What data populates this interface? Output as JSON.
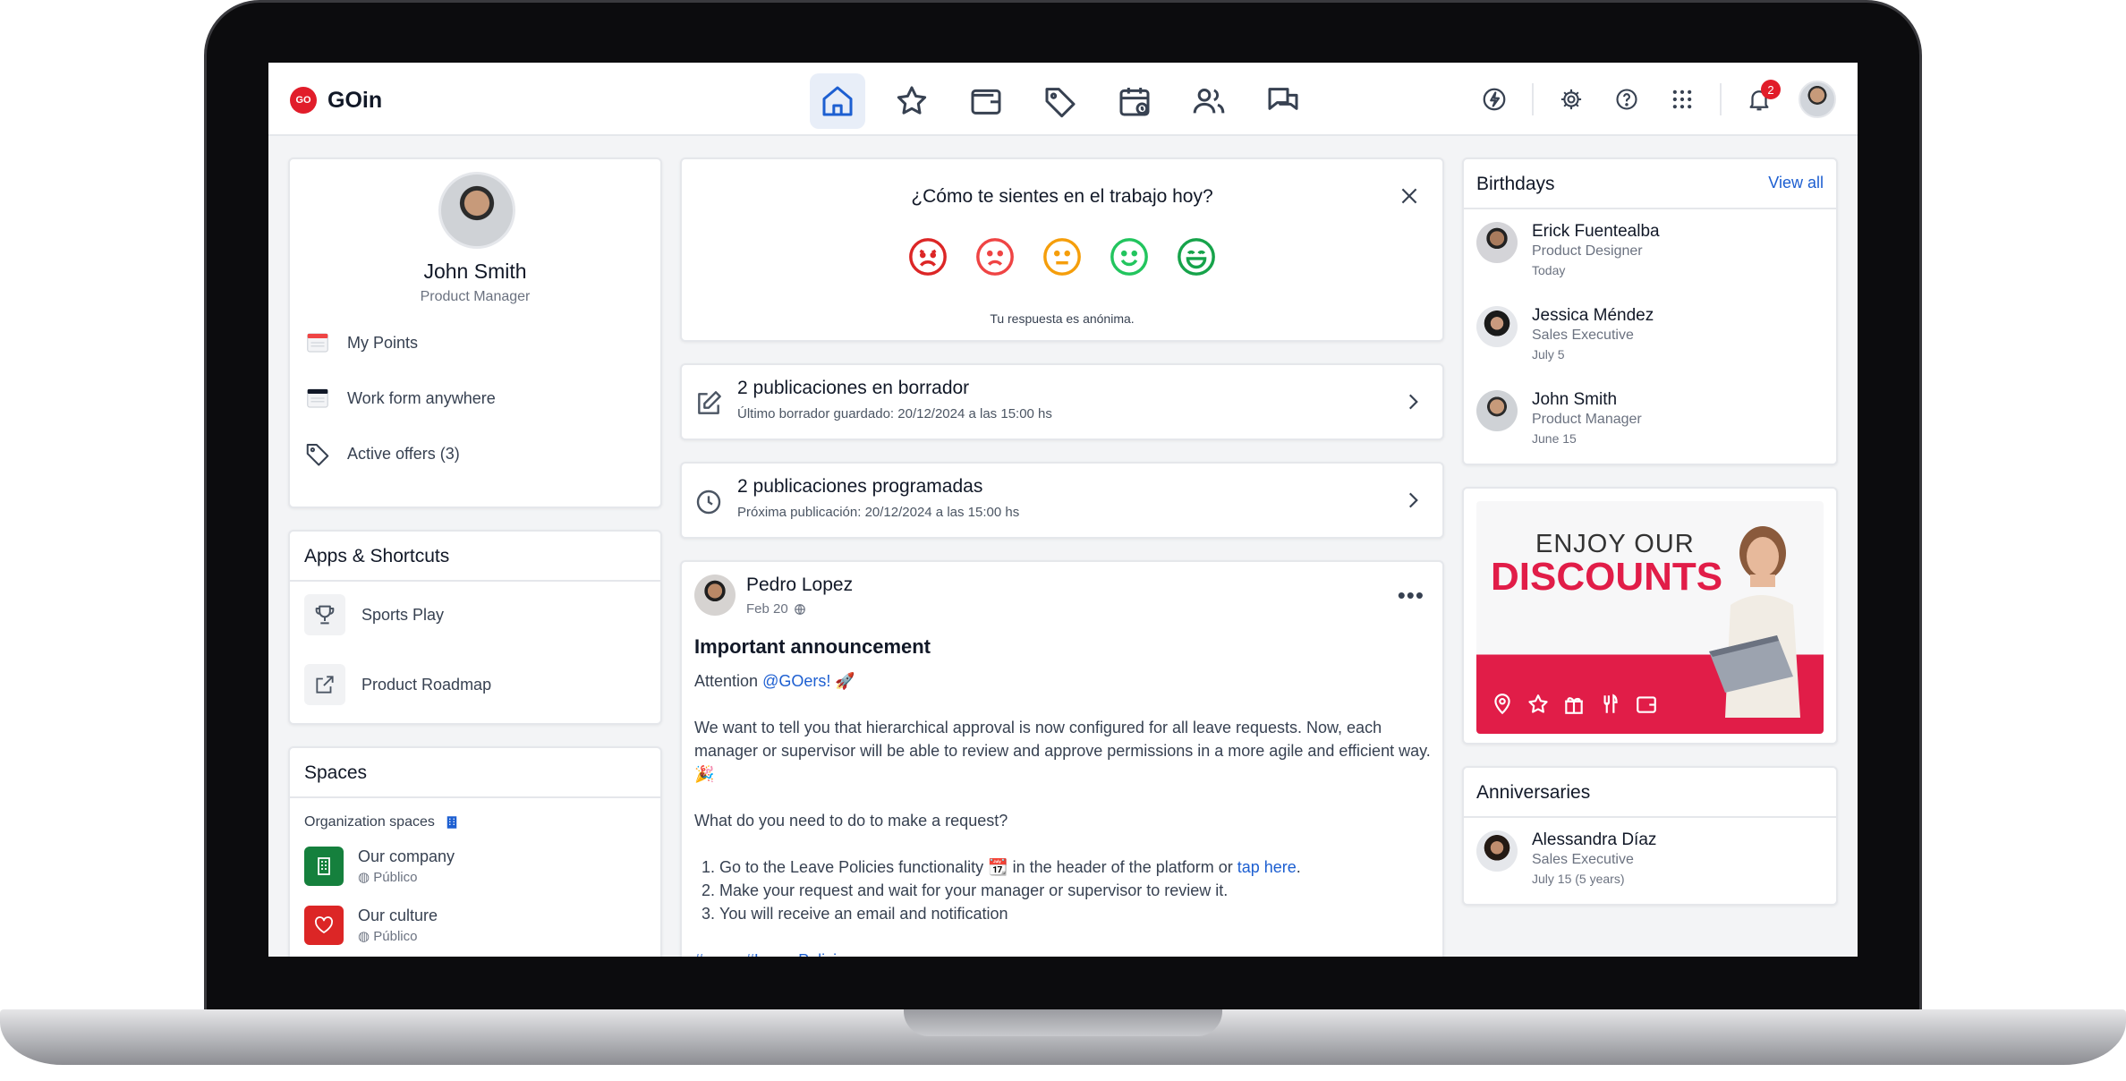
{
  "app": {
    "logo_badge": "GO",
    "name": "GOin"
  },
  "nav": {
    "icons": [
      "home-icon",
      "star-icon",
      "wallet-icon",
      "tag-icon",
      "calendar-icon",
      "people-icon",
      "chat-icon"
    ],
    "active": "home-icon"
  },
  "topbar": {
    "notification_count": "2"
  },
  "profile": {
    "name": "John Smith",
    "role": "Product Manager",
    "links": [
      "My Points",
      "Work form anywhere",
      "Active offers (3)"
    ]
  },
  "apps": {
    "title": "Apps & Shortcuts",
    "items": [
      "Sports Play",
      "Product Roadmap"
    ]
  },
  "spaces": {
    "title": "Spaces",
    "section": "Organization spaces",
    "items": [
      {
        "name": "Our company",
        "visibility": "Público",
        "color": "#15803d"
      },
      {
        "name": "Our culture",
        "visibility": "Público",
        "color": "#dc2626"
      }
    ]
  },
  "mood": {
    "question": "¿Cómo te sientes en el trabajo hoy?",
    "note": "Tu respuesta es anónima.",
    "face_colors": [
      "#dc2626",
      "#ef4444",
      "#f59e0b",
      "#22c55e",
      "#16a34a"
    ]
  },
  "drafts": {
    "title": "2 publicaciones en borrador",
    "subtitle": "Último borrador guardado: 20/12/2024 a las 15:00 hs"
  },
  "scheduled": {
    "title": "2 publicaciones programadas",
    "subtitle": "Próxima publicación: 20/12/2024 a las 15:00 hs"
  },
  "post": {
    "author": "Pedro Lopez",
    "date": "Feb 20",
    "title": "Important announcement",
    "attention": "Attention ",
    "mention": "@GOers!",
    "attention_emoji": "🚀",
    "para1": "We want to tell you that hierarchical approval is now configured for all leave requests. Now, each manager or supervisor will be able to review and approve permissions in a more agile and efficient way. 🎉",
    "question": "What do you need to do to make a request?",
    "step1_pre": "Go to the Leave Policies functionality 📆 in the header of the platform or ",
    "step1_link": "tap here",
    "step1_post": ".",
    "step2": "Make your request and wait for your manager or supervisor to review it.",
    "step3": "You will receive an email and notification",
    "tags": "#news #LeavePolicies"
  },
  "birthdays": {
    "title": "Birthdays",
    "view_all": "View all",
    "people": [
      {
        "name": "Erick Fuentealba",
        "role": "Product Designer",
        "date": "Today"
      },
      {
        "name": "Jessica Méndez",
        "role": "Sales Executive",
        "date": "July 5"
      },
      {
        "name": "John Smith",
        "role": "Product Manager",
        "date": "June 15"
      }
    ]
  },
  "promo": {
    "line1": "ENJOY OUR",
    "line2": "DISCOUNTS",
    "accent": "#e11d48"
  },
  "anniversaries": {
    "title": "Anniversaries",
    "people": [
      {
        "name": "Alessandra Díaz",
        "role": "Sales Executive",
        "date": "July 15 (5 years)"
      }
    ]
  }
}
